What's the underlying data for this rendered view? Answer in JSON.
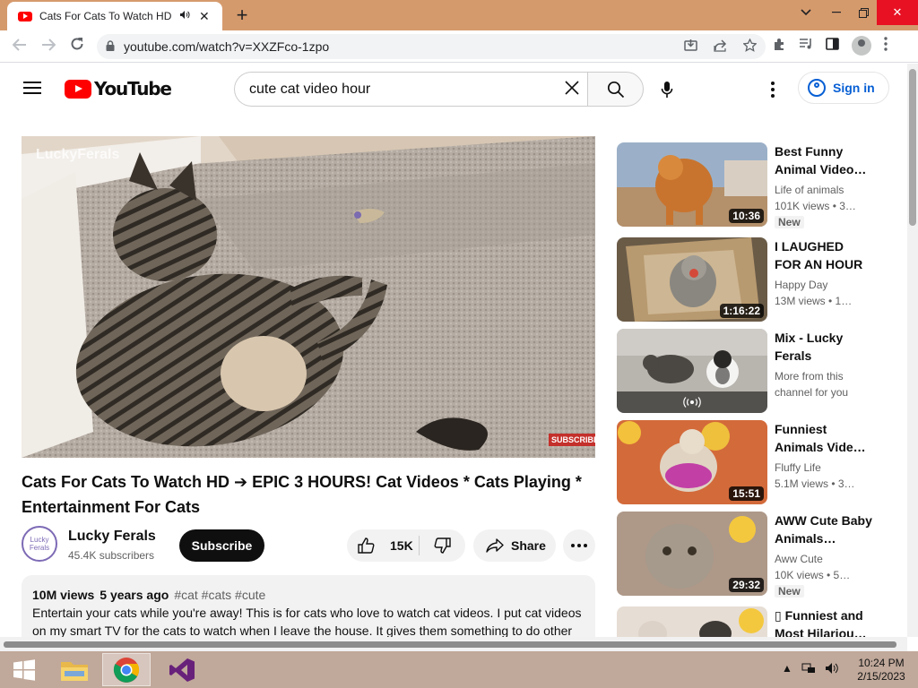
{
  "browser": {
    "tab_title": "Cats For Cats To Watch HD –",
    "tab_audio_icon": "speaker-icon",
    "url": "youtube.com/watch?v=XXZFco-1zpo"
  },
  "youtube": {
    "logo_text": "YouTube",
    "search_value": "cute cat video hour",
    "signin_label": "Sign in",
    "watermark": "LuckyFerals",
    "subscribe_badge": "SUBSCRIBE",
    "video": {
      "title": "Cats For Cats To Watch HD ➔ EPIC 3 HOURS! Cat Videos * Cats Playing * Entertainment For Cats",
      "channel": "Lucky Ferals",
      "avatar_text": "Lucky Ferals",
      "subscribers": "45.4K subscribers",
      "subscribe_label": "Subscribe",
      "likes": "15K",
      "share_label": "Share",
      "views": "10M views",
      "age": "5 years ago",
      "tags": "#cat #cats #cute",
      "description": "Entertain your cats while you're away! This is for cats who love to watch cat videos. I put cat videos on my smart TV for the cats to watch when I leave the house. It gives them something to do other"
    },
    "recommendations": [
      {
        "title": "Best Funny Animal Video…",
        "channel": "Life of animals",
        "meta": "101K views • 3…",
        "duration": "10:36",
        "badge": "New"
      },
      {
        "title": "I LAUGHED FOR AN HOUR😹…",
        "channel": "Happy Day",
        "meta": "13M views • 1…",
        "duration": "1:16:22",
        "badge": ""
      },
      {
        "title": "Mix - Lucky Ferals",
        "channel": "More from this channel for you",
        "meta": "",
        "duration": "",
        "badge": ""
      },
      {
        "title": "Funniest Animals Vide…",
        "channel": "Fluffy Life",
        "meta": "5.1M views • 3…",
        "duration": "15:51",
        "badge": ""
      },
      {
        "title": "AWW Cute Baby Animals…",
        "channel": "Aww Cute",
        "meta": "10K views • 5…",
        "duration": "29:32",
        "badge": "New"
      },
      {
        "title": "▯ Funniest and Most Hilariou…",
        "channel": "",
        "meta": "",
        "duration": "",
        "badge": ""
      }
    ]
  },
  "taskbar": {
    "time": "10:24 PM",
    "date": "2/15/2023"
  }
}
